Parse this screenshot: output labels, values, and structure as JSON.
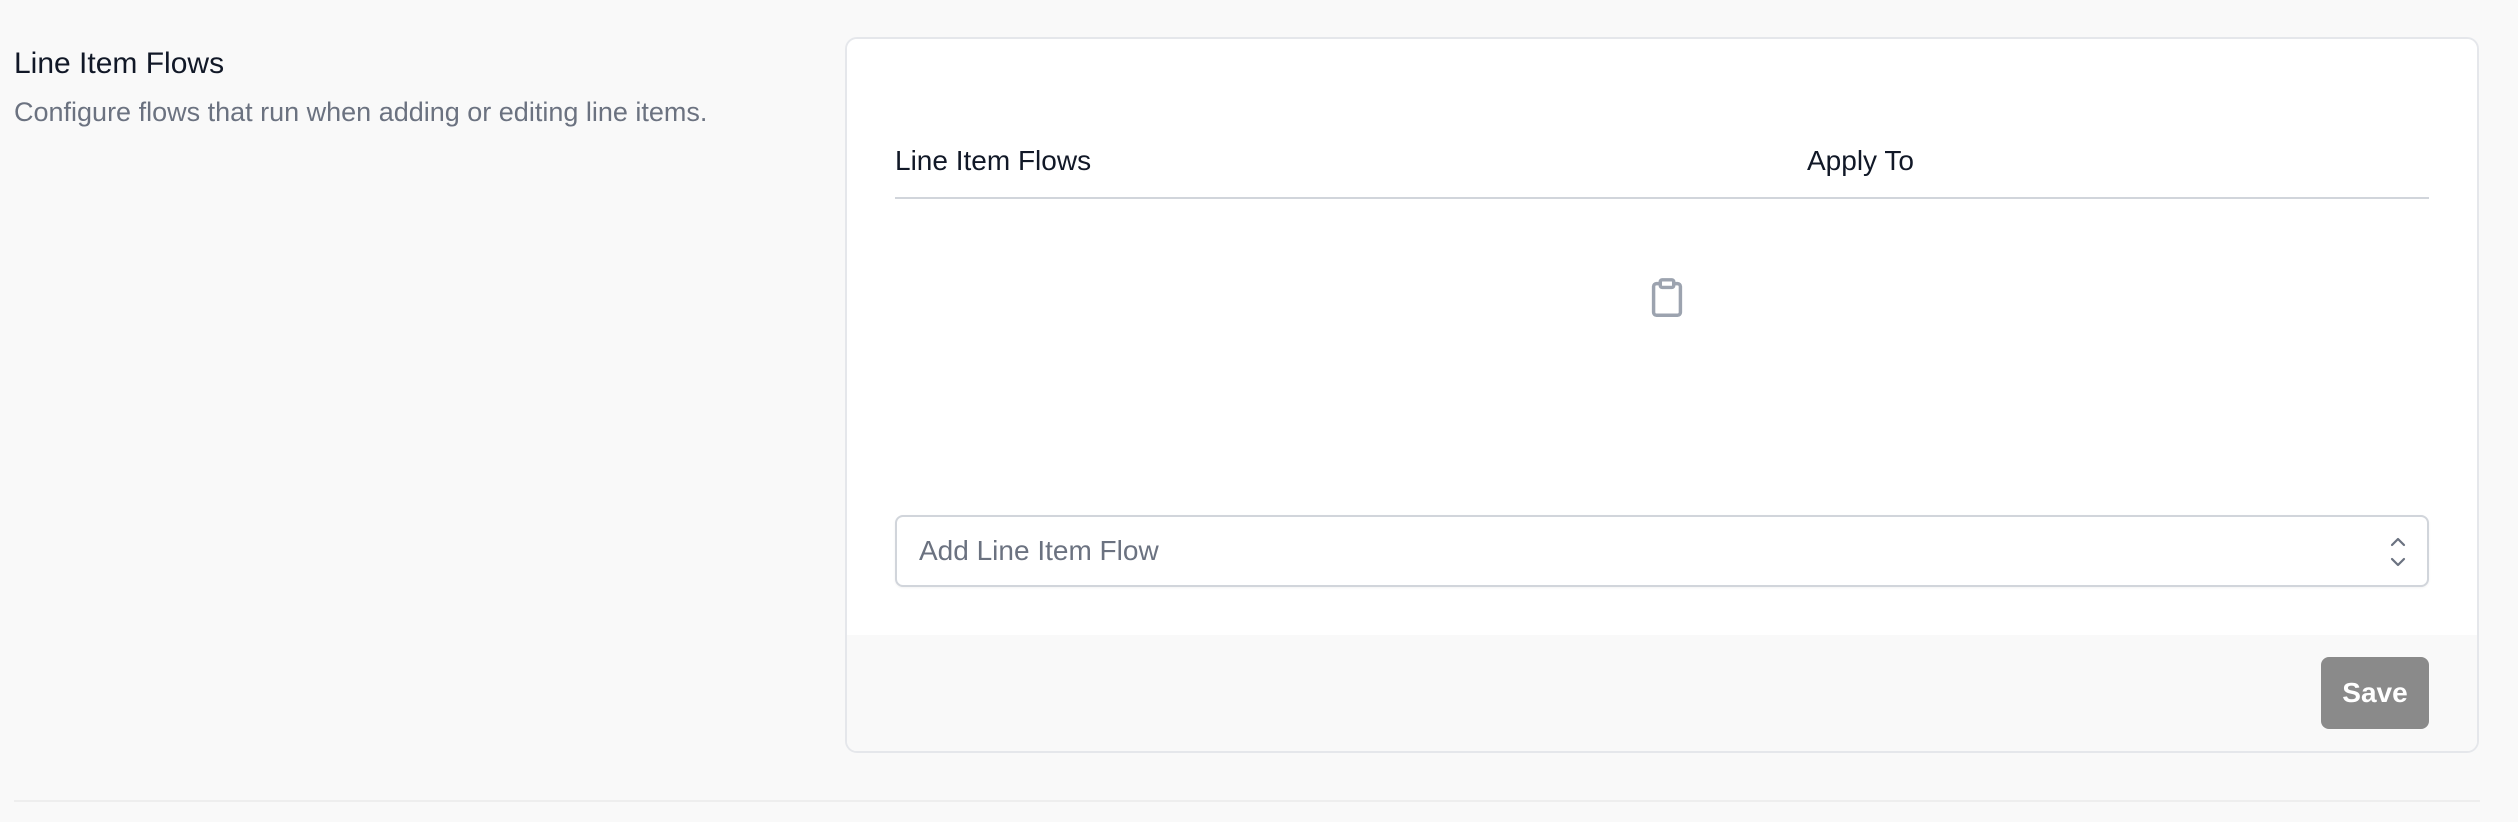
{
  "section": {
    "title": "Line Item Flows",
    "description": "Configure flows that run when adding or editing line items."
  },
  "table": {
    "columns": [
      "Line Item Flows",
      "Apply To"
    ],
    "rows": [],
    "empty_icon": "clipboard-icon"
  },
  "add_flow_select": {
    "placeholder": "Add Line Item Flow",
    "icon": "chevron-up-down-icon"
  },
  "footer": {
    "save_label": "Save"
  },
  "colors": {
    "save_button_bg": "#8a8a8a",
    "border": "#e5e7eb",
    "muted_text": "#6b7280",
    "icon": "#9ca3af"
  }
}
